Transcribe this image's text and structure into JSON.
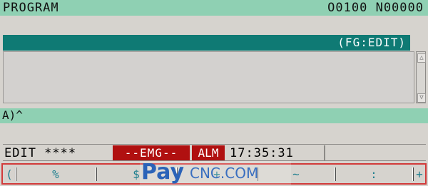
{
  "header": {
    "title": "PROGRAM",
    "program_numbers": "O0100 N00000"
  },
  "editor": {
    "mode": "(FG:EDIT)",
    "scroll_up": "△",
    "scroll_down": "▽"
  },
  "input": {
    "line": "A)^"
  },
  "status": {
    "mode_text": "EDIT ****",
    "emergency": "--EMG--",
    "alarm": "ALM",
    "time": "17:35:31"
  },
  "softkeys": {
    "left_arrow": "(",
    "keys": [
      "%",
      "$",
      "+",
      "~",
      ":"
    ],
    "right_arrow": "+"
  },
  "watermark": {
    "brand": "Pay",
    "rest": "CNC.COM"
  },
  "colors": {
    "green_bar": "#8fd0b3",
    "teal_bar": "#0f7a74",
    "alarm_red": "#b01010"
  }
}
